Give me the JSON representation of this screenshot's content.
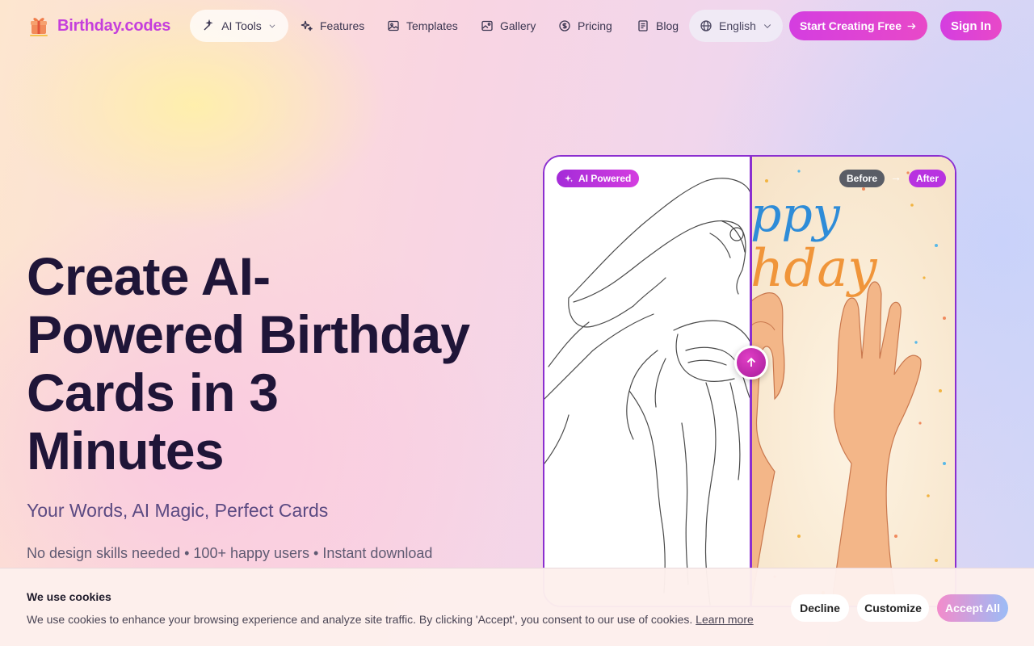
{
  "brand": {
    "name": "Birthday.codes"
  },
  "nav": {
    "ai_tools": "AI Tools",
    "features": "Features",
    "templates": "Templates",
    "gallery": "Gallery",
    "pricing": "Pricing",
    "blog": "Blog",
    "language": "English",
    "start_cta": "Start Creating Free",
    "sign_in": "Sign In"
  },
  "hero": {
    "title_lines": [
      "Create AI-",
      "Powered Birthday",
      "Cards in 3",
      "Minutes"
    ],
    "subtitle": "Your Words, AI Magic, Perfect Cards",
    "meta": "No design skills needed • 100+ happy users • Instant download"
  },
  "compare": {
    "ai_badge": "AI Powered",
    "before": "Before",
    "after": "After",
    "card_text_top": "ppy",
    "card_text_bottom": "hday"
  },
  "cookie": {
    "title": "We use cookies",
    "text": "We use cookies to enhance your browsing experience and analyze site traffic. By clicking 'Accept', you consent to our use of cookies.",
    "learn_more": "Learn more",
    "decline": "Decline",
    "customize": "Customize",
    "accept_all": "Accept All"
  },
  "colors": {
    "brand": "#c53fdc",
    "accent": "#8b2fd0",
    "title": "#1f1538"
  }
}
